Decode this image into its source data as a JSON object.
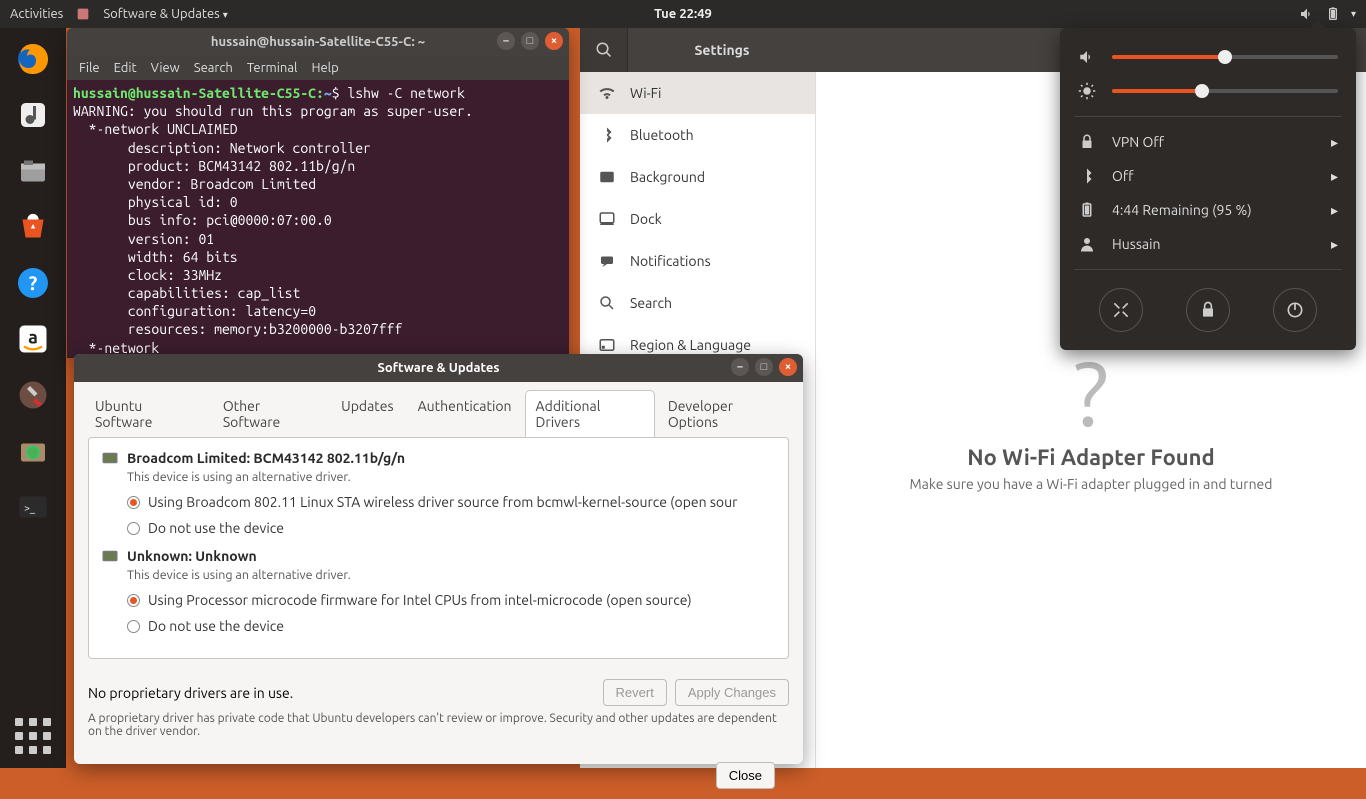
{
  "topbar": {
    "activities": "Activities",
    "app_label": "Software & Updates",
    "clock": "Tue 22:49"
  },
  "launcher": {
    "items": [
      "firefox",
      "rhythmbox",
      "files",
      "software-center",
      "help",
      "amazon",
      "preferences",
      "updates",
      "terminal"
    ]
  },
  "terminal": {
    "title": "hussain@hussain-Satellite-C55-C: ~",
    "menu": [
      "File",
      "Edit",
      "View",
      "Search",
      "Terminal",
      "Help"
    ],
    "prompt_user": "hussain@hussain-Satellite-C55-C:",
    "prompt_path": "~",
    "command": "lshw -C network",
    "output": "WARNING: you should run this program as super-user.\n  *-network UNCLAIMED\n       description: Network controller\n       product: BCM43142 802.11b/g/n\n       vendor: Broadcom Limited\n       physical id: 0\n       bus info: pci@0000:07:00.0\n       version: 01\n       width: 64 bits\n       clock: 33MHz\n       capabilities: cap_list\n       configuration: latency=0\n       resources: memory:b3200000-b3207fff\n  *-network"
  },
  "software_updates": {
    "title": "Software & Updates",
    "tabs": [
      "Ubuntu Software",
      "Other Software",
      "Updates",
      "Authentication",
      "Additional Drivers",
      "Developer Options"
    ],
    "active_tab": "Additional Drivers",
    "devices": [
      {
        "name": "Broadcom Limited: BCM43142 802.11b/g/n",
        "status": "This device is using an alternative driver.",
        "options": [
          {
            "label": "Using Broadcom 802.11 Linux STA wireless driver source from bcmwl-kernel-source (open sour",
            "selected": true
          },
          {
            "label": "Do not use the device",
            "selected": false
          }
        ]
      },
      {
        "name": "Unknown: Unknown",
        "status": "This device is using an alternative driver.",
        "options": [
          {
            "label": "Using Processor microcode firmware for Intel CPUs from intel-microcode (open source)",
            "selected": true
          },
          {
            "label": "Do not use the device",
            "selected": false
          }
        ]
      }
    ],
    "summary": "No proprietary drivers are in use.",
    "note": "A proprietary driver has private code that Ubuntu developers can't review or improve. Security and other updates are dependent on the driver vendor.",
    "buttons": {
      "revert": "Revert",
      "apply": "Apply Changes",
      "close": "Close"
    }
  },
  "settings": {
    "title": "Settings",
    "sidebar": [
      {
        "label": "Wi-Fi",
        "icon": "wifi",
        "active": true
      },
      {
        "label": "Bluetooth",
        "icon": "bluetooth"
      },
      {
        "label": "Background",
        "icon": "background"
      },
      {
        "label": "Dock",
        "icon": "dock"
      },
      {
        "label": "Notifications",
        "icon": "notifications"
      },
      {
        "label": "Search",
        "icon": "search"
      },
      {
        "label": "Region & Language",
        "icon": "region"
      }
    ],
    "wifi_notfound": {
      "heading": "No Wi-Fi Adapter Found",
      "sub": "Make sure you have a Wi-Fi adapter plugged in and turned"
    }
  },
  "popover": {
    "volume_pct": 50,
    "brightness_pct": 40,
    "items": [
      {
        "icon": "lock",
        "label": "VPN Off"
      },
      {
        "icon": "bluetooth",
        "label": "Off"
      },
      {
        "icon": "battery",
        "label": "4:44 Remaining (95 %)"
      },
      {
        "icon": "user",
        "label": "Hussain"
      }
    ]
  }
}
